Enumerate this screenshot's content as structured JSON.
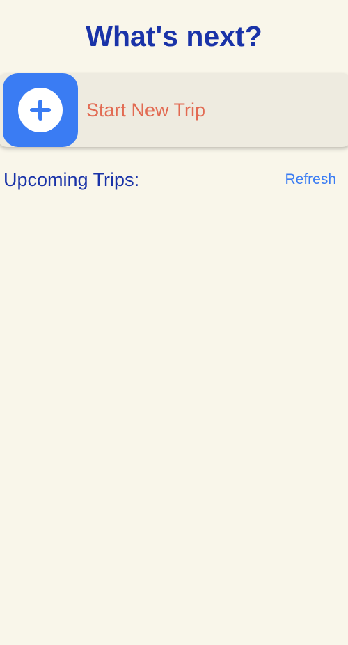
{
  "header": {
    "title": "What's next?"
  },
  "start_trip": {
    "label": "Start New Trip",
    "icon": "plus-icon"
  },
  "upcoming": {
    "title": "Upcoming Trips:",
    "refresh_label": "Refresh",
    "trips": []
  },
  "colors": {
    "background": "#f9f6ea",
    "title": "#1a33a8",
    "accent_blue": "#3a7cf3",
    "start_label": "#e26a52",
    "card": "#eeebe0"
  }
}
